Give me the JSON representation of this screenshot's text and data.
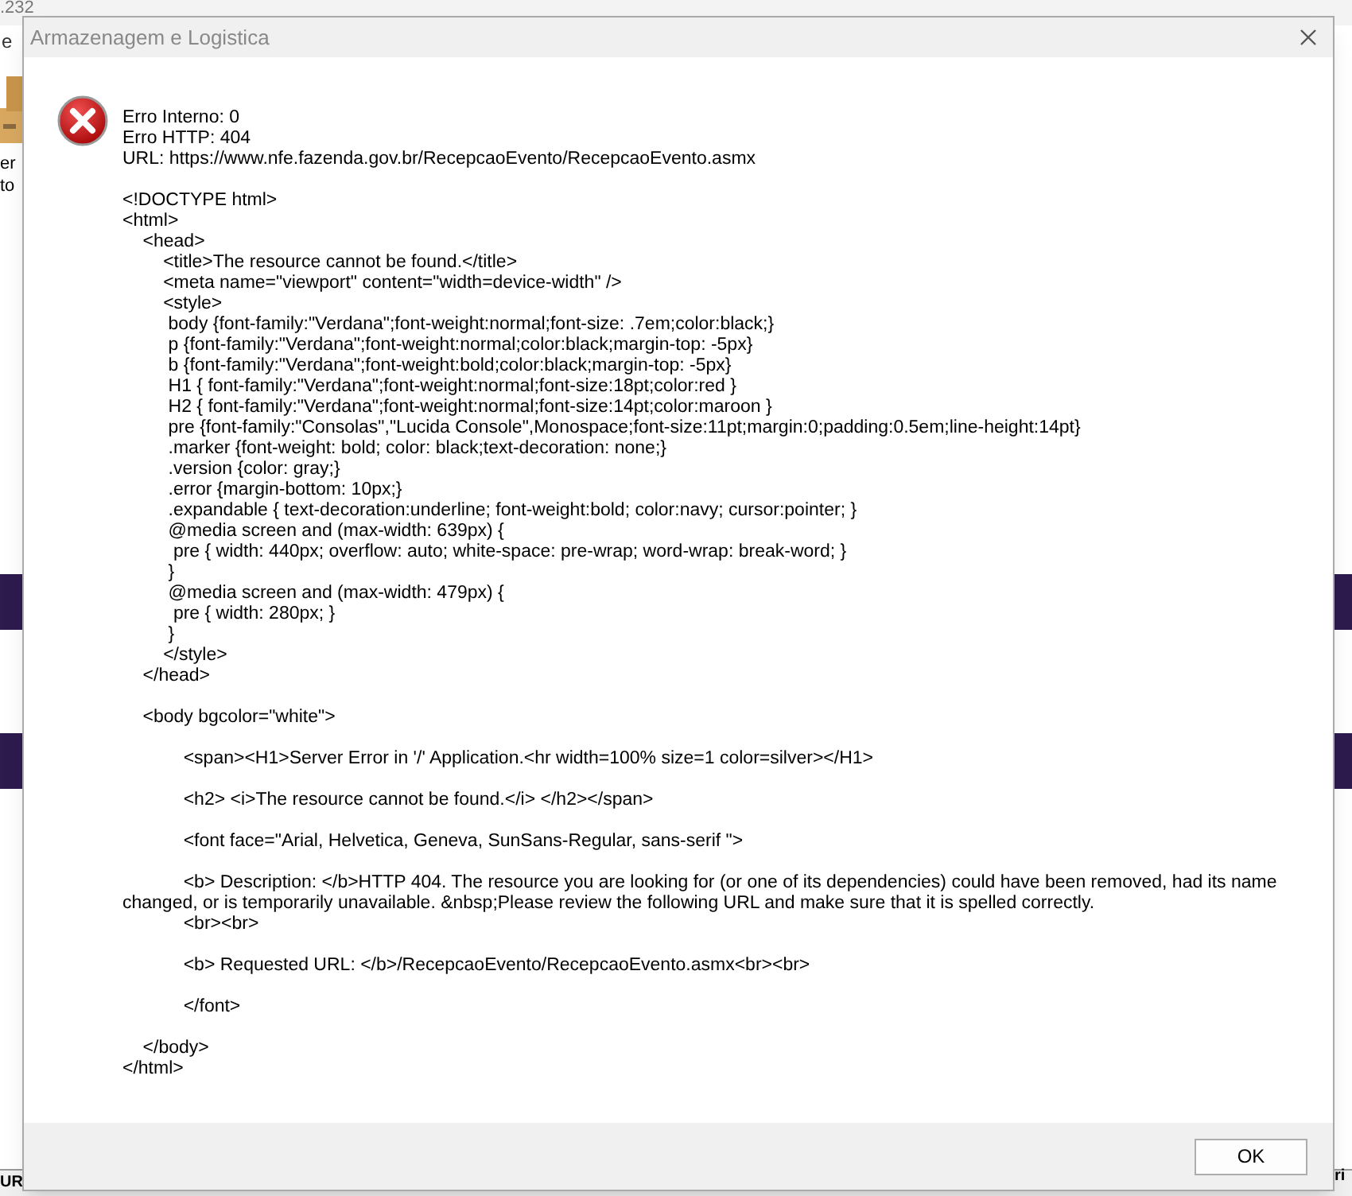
{
  "background_window": {
    "title_fragment": ".232",
    "field_fragment": "e",
    "icon_label_lines": [
      "er",
      "to"
    ],
    "bottom_left_fragment": "UR",
    "bottom_right_fragment": "ri"
  },
  "dialog": {
    "title": "Armazenagem e Logistica",
    "kind": "error",
    "message": "Erro Interno: 0\nErro HTTP: 404\nURL: https://www.nfe.fazenda.gov.br/RecepcaoEvento/RecepcaoEvento.asmx\n\n<!DOCTYPE html>\n<html>\n    <head>\n        <title>The resource cannot be found.</title>\n        <meta name=\"viewport\" content=\"width=device-width\" />\n        <style>\n         body {font-family:\"Verdana\";font-weight:normal;font-size: .7em;color:black;}\n         p {font-family:\"Verdana\";font-weight:normal;color:black;margin-top: -5px}\n         b {font-family:\"Verdana\";font-weight:bold;color:black;margin-top: -5px}\n         H1 { font-family:\"Verdana\";font-weight:normal;font-size:18pt;color:red }\n         H2 { font-family:\"Verdana\";font-weight:normal;font-size:14pt;color:maroon }\n         pre {font-family:\"Consolas\",\"Lucida Console\",Monospace;font-size:11pt;margin:0;padding:0.5em;line-height:14pt}\n         .marker {font-weight: bold; color: black;text-decoration: none;}\n         .version {color: gray;}\n         .error {margin-bottom: 10px;}\n         .expandable { text-decoration:underline; font-weight:bold; color:navy; cursor:pointer; }\n         @media screen and (max-width: 639px) {\n          pre { width: 440px; overflow: auto; white-space: pre-wrap; word-wrap: break-word; }\n         }\n         @media screen and (max-width: 479px) {\n          pre { width: 280px; }\n         }\n        </style>\n    </head>\n\n    <body bgcolor=\"white\">\n\n            <span><H1>Server Error in '/' Application.<hr width=100% size=1 color=silver></H1>\n\n            <h2> <i>The resource cannot be found.</i> </h2></span>\n\n            <font face=\"Arial, Helvetica, Geneva, SunSans-Regular, sans-serif \">\n\n            <b> Description: </b>HTTP 404. The resource you are looking for (or one of its dependencies) could have been removed, had its name changed, or is temporarily unavailable. &nbsp;Please review the following URL and make sure that it is spelled correctly.\n            <br><br>\n\n            <b> Requested URL: </b>/RecepcaoEvento/RecepcaoEvento.asmx<br><br>\n\n            </font>\n\n    </body>\n</html>",
    "buttons": [
      {
        "label": "OK"
      }
    ]
  }
}
